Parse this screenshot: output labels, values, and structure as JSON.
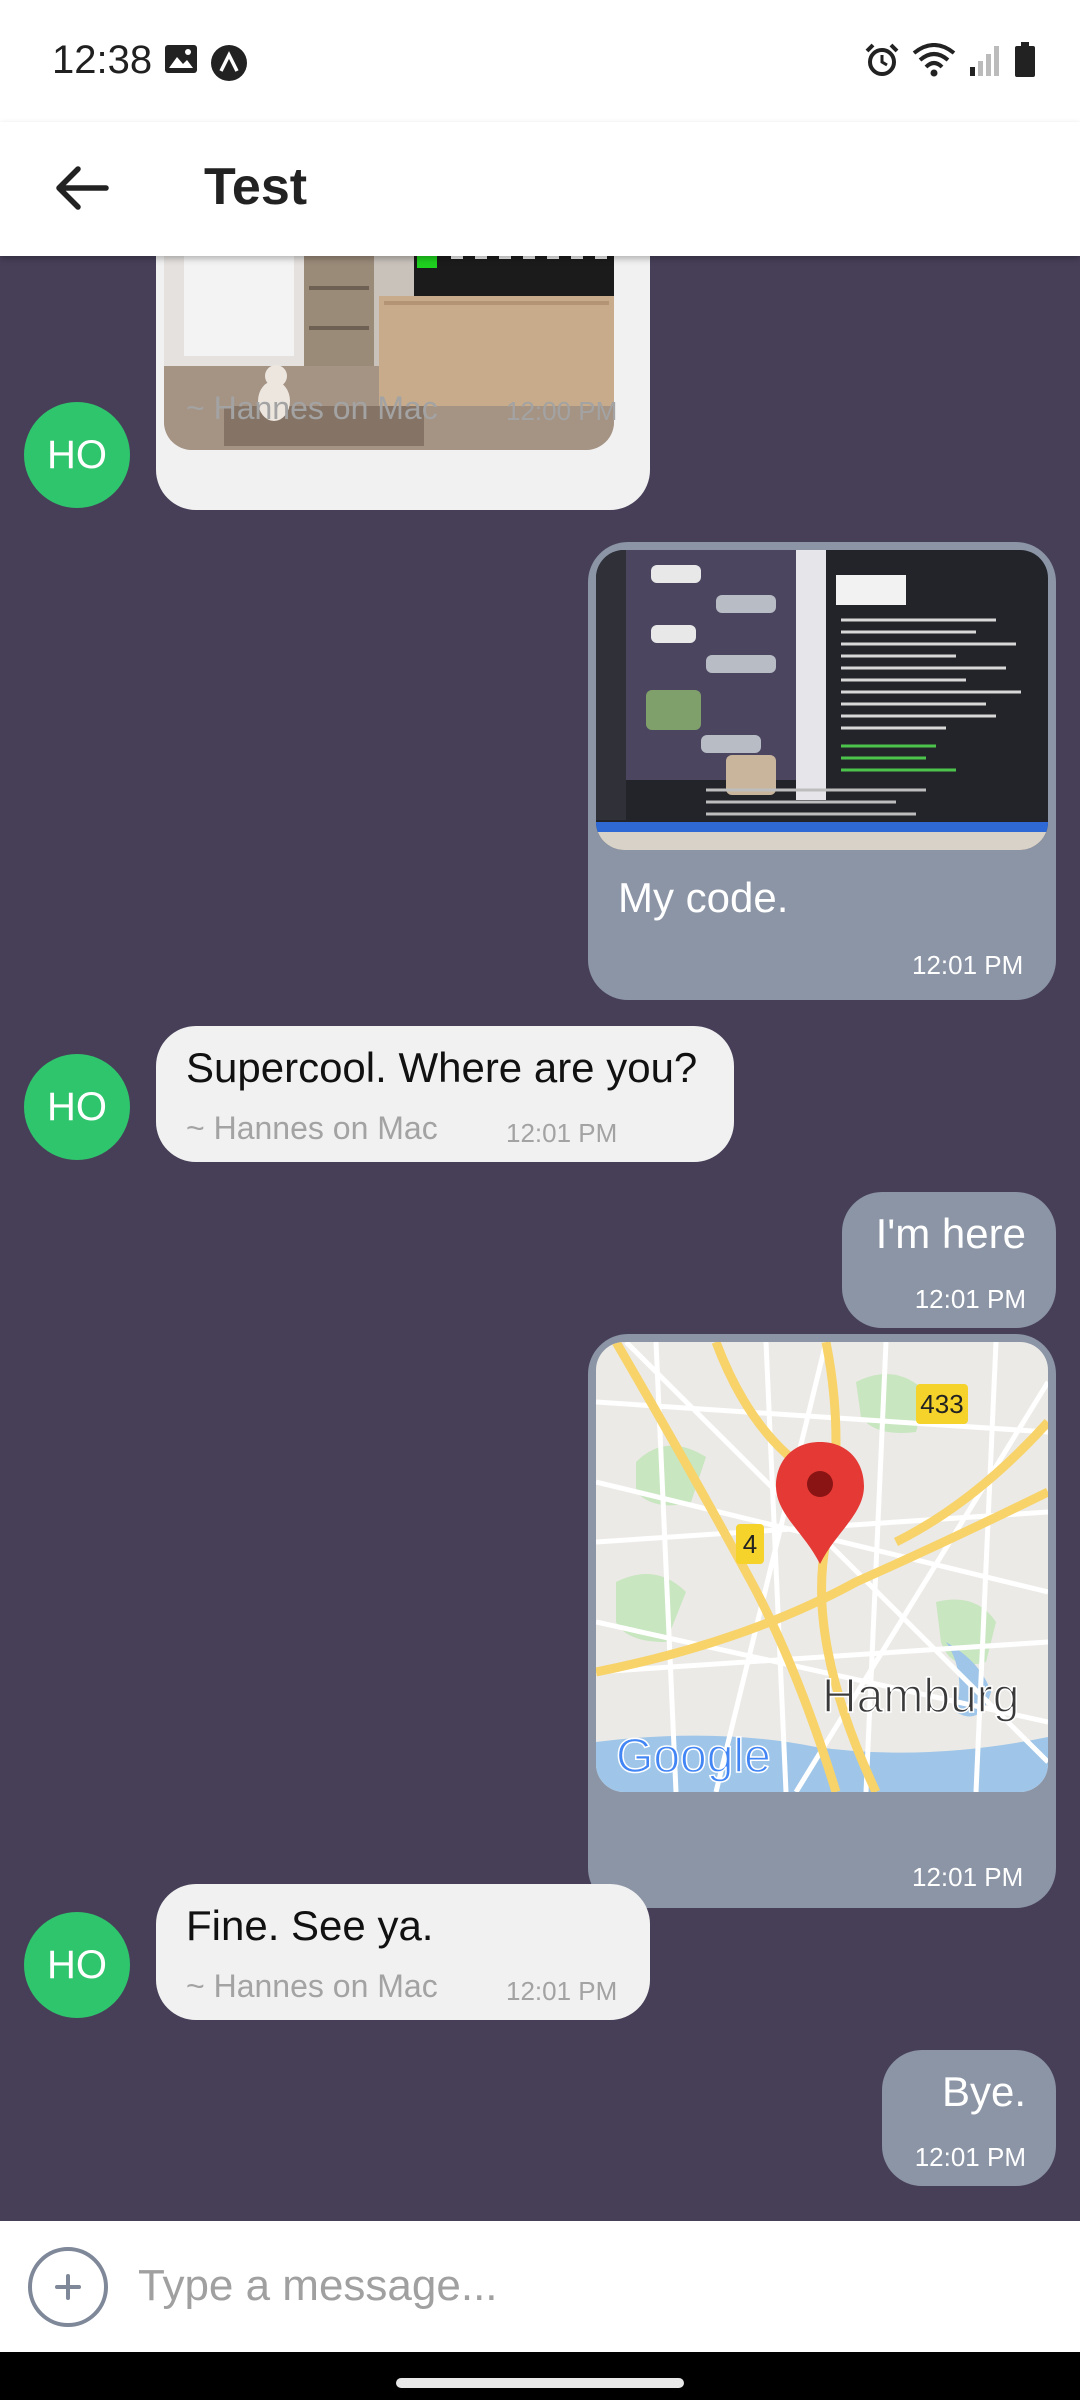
{
  "status_bar": {
    "time": "12:38",
    "left_icons": [
      "image-icon",
      "app-a-icon"
    ],
    "right_icons": [
      "alarm-icon",
      "wifi-icon",
      "signal-icon",
      "battery-icon"
    ]
  },
  "app_bar": {
    "title": "Test",
    "back_icon": "arrow-left-icon"
  },
  "colors": {
    "chat_background": "#473f58",
    "incoming_bubble": "#f1f1f1",
    "outgoing_bubble": "#8b95a6",
    "avatar": "#2fc56d"
  },
  "messages": [
    {
      "direction": "in",
      "type": "image",
      "author": "~ Hannes on Mac",
      "time": "12:00 PM",
      "avatar": "HO",
      "image": "cat-by-tv-photo"
    },
    {
      "direction": "out",
      "type": "image",
      "text": "My code.",
      "time": "12:01 PM",
      "image": "laptop-code-screen-photo"
    },
    {
      "direction": "in",
      "type": "text",
      "text": "Supercool. Where are you?",
      "author": "~ Hannes on Mac",
      "time": "12:01 PM",
      "avatar": "HO"
    },
    {
      "direction": "out",
      "type": "text",
      "text": "I'm here",
      "time": "12:01 PM"
    },
    {
      "direction": "out",
      "type": "location",
      "time": "12:01 PM",
      "map": {
        "city_label": "Hamburg",
        "road_badges": [
          "433",
          "4"
        ],
        "brand": "Google"
      }
    },
    {
      "direction": "in",
      "type": "text",
      "text": "Fine. See ya.",
      "author": "~ Hannes on Mac",
      "time": "12:01 PM",
      "avatar": "HO"
    },
    {
      "direction": "out",
      "type": "text",
      "text": "Bye.",
      "time": "12:01 PM"
    }
  ],
  "composer": {
    "placeholder": "Type a message...",
    "value": "",
    "add_icon": "plus-icon"
  }
}
